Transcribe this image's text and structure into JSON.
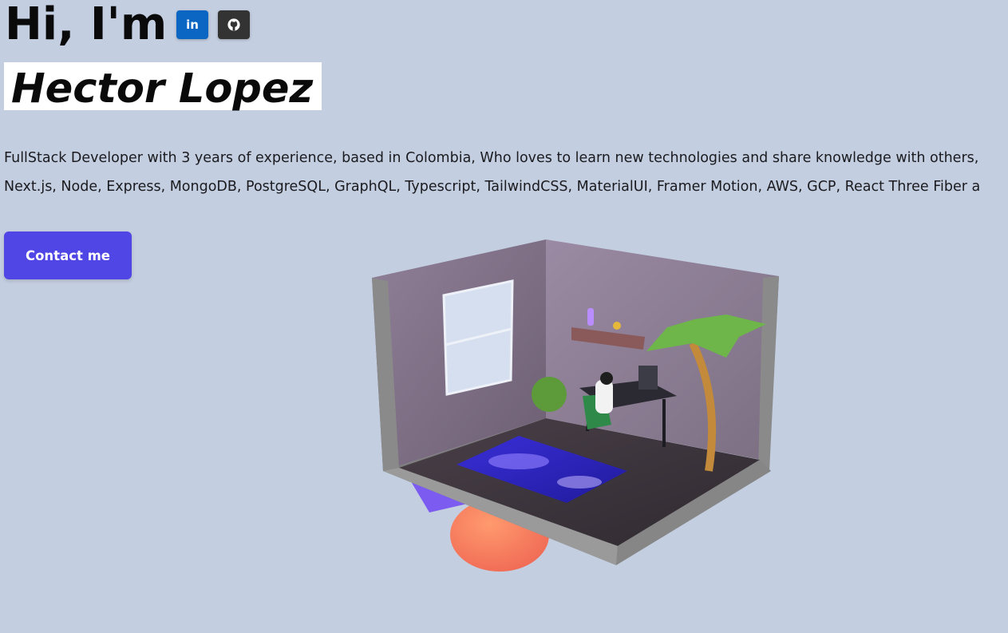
{
  "hero": {
    "greeting": "Hi, I'm",
    "name": "Hector Lopez",
    "bio_line_1": "FullStack Developer with 3 years of experience, based in Colombia, Who loves to learn new technologies and share knowledge with others,",
    "bio_line_2": "Next.js, Node, Express, MongoDB, PostgreSQL, GraphQL, Typescript, TailwindCSS, MaterialUI, Framer Motion, AWS, GCP, React Three Fiber a",
    "cta_label": "Contact me"
  },
  "social": {
    "linkedin": {
      "label": "in",
      "icon": "linkedin-icon",
      "color": "#0a66c2"
    },
    "github": {
      "icon": "github-icon",
      "color": "#333333"
    }
  },
  "scene": {
    "description_icon": "isometric-room-illustration"
  },
  "colors": {
    "background": "#c3cee0",
    "accent": "#4f46e5",
    "name_highlight": "#ffffff"
  }
}
